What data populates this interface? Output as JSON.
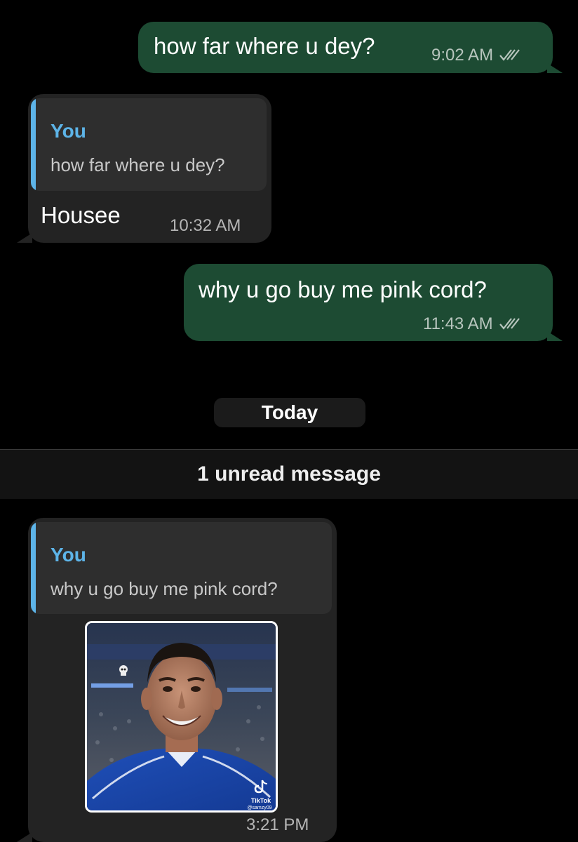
{
  "messages": [
    {
      "direction": "outgoing",
      "text": "how far where u dey?",
      "time": "9:02 AM",
      "status": "double-check-icon"
    },
    {
      "direction": "incoming",
      "reply_to": {
        "author": "You",
        "text": "how far where u dey?"
      },
      "text": "Housee",
      "time": "10:32 AM"
    },
    {
      "direction": "outgoing",
      "text": "why u go buy me pink cord?",
      "time": "11:43 AM",
      "status": "double-check-icon"
    },
    {
      "direction": "incoming",
      "reply_to": {
        "author": "You",
        "text": "why u go buy me pink cord?"
      },
      "media": {
        "type": "image",
        "description": "smiling footballer in blue jersey",
        "watermark_brand": "TikTok",
        "watermark_handle": "@samzy09"
      },
      "time": "3:21 PM"
    }
  ],
  "date_divider": "Today",
  "unread_banner": "1 unread message",
  "colors": {
    "background": "#000000",
    "outgoing_bubble": "#1d4b33",
    "incoming_bubble": "#232323",
    "reply_accent": "#5db4e8"
  }
}
